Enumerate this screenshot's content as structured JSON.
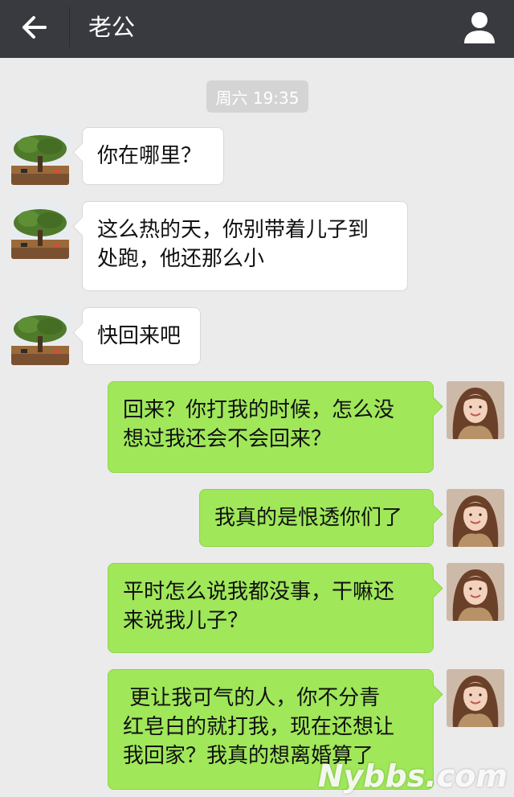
{
  "header": {
    "title": "老公",
    "back_icon": "arrow-left-icon",
    "profile_icon": "person-icon"
  },
  "timestamp": "周六 19:35",
  "messages": [
    {
      "side": "incoming",
      "text": "你在哪里？"
    },
    {
      "side": "incoming",
      "text": "这么热的天，你别带着儿子到\n处跑，他还那么小"
    },
    {
      "side": "incoming",
      "text": "快回来吧"
    },
    {
      "side": "outgoing",
      "text": "回来？你打我的时候，怎么没\n想过我还会不会回来？"
    },
    {
      "side": "outgoing",
      "text": "我真的是恨透你们了"
    },
    {
      "side": "outgoing",
      "text": "平时怎么说我都没事，干嘛还\n来说我儿子？"
    },
    {
      "side": "outgoing",
      "text": " 更让我可气的人，你不分青\n红皂白的就打我，现在还想让\n我回家？我真的想离婚算了"
    }
  ],
  "watermark": "Nybbs.com",
  "colors": {
    "topbar": "#393a3f",
    "background": "#ebebeb",
    "outgoing_bubble": "#a0e75a",
    "incoming_bubble": "#ffffff"
  }
}
